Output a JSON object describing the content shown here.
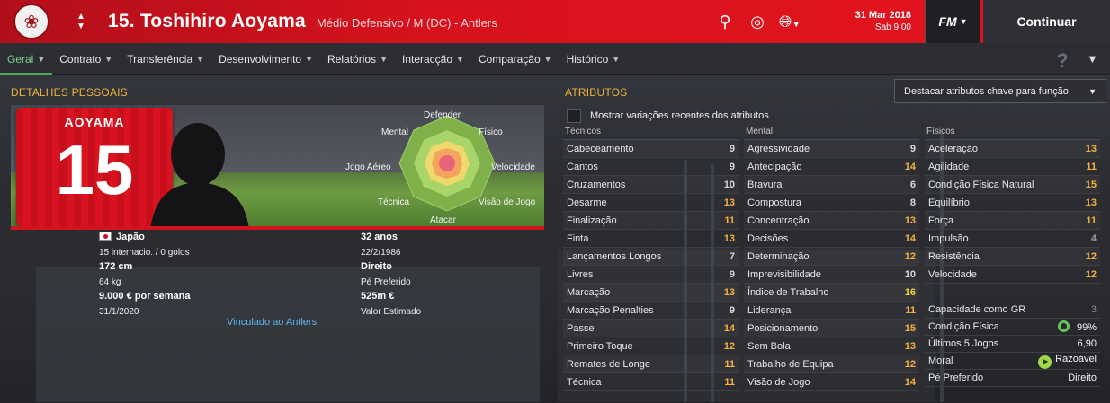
{
  "header": {
    "player_title": "15. Toshihiro Aoyama",
    "subtitle": "Médio Defensivo / M (DC) - Antlers",
    "date_line1": "31 Mar 2018",
    "date_line2": "Sab 9:00",
    "fm_label": "FM",
    "continue_label": "Continuar"
  },
  "tabs": [
    {
      "label": "Geral"
    },
    {
      "label": "Contrato"
    },
    {
      "label": "Transferência"
    },
    {
      "label": "Desenvolvimento"
    },
    {
      "label": "Relatórios"
    },
    {
      "label": "Interacção"
    },
    {
      "label": "Comparação"
    },
    {
      "label": "Histórico"
    }
  ],
  "personal": {
    "section_title": "DETALHES PESSOAIS",
    "shirt_name": "AOYAMA",
    "shirt_number": "15",
    "polar": {
      "top": "Defender",
      "top_left": "Mental",
      "top_right": "Físico",
      "left": "Jogo Aéreo",
      "right": "Velocidade",
      "bottom_left": "Técnica",
      "bottom_right": "Visão de Jogo",
      "bottom": "Atacar"
    },
    "nation": "Japão",
    "caps": "15 internacio. / 0 golos",
    "height": "172 cm",
    "weight": "64 kg",
    "wage": "9.000 € por semana",
    "contract_end": "31/1/2020",
    "age": "32 anos",
    "dob": "22/2/1986",
    "foot": "Direito",
    "foot_label": "Pé Preferido",
    "value": "525m €",
    "value_label": "Valor Estimado",
    "club_link": "Vinculado ao Antlers"
  },
  "attributes": {
    "section_title": "ATRIBUTOS",
    "dropdown": "Destacar atributos chave para função",
    "checkbox_label": "Mostrar variações recentes dos atributos",
    "technical_title": "Técnicos",
    "mental_title": "Mental",
    "physical_title": "Físicos",
    "technical": [
      {
        "name": "Cabeceamento",
        "value": "9",
        "c": ""
      },
      {
        "name": "Cantos",
        "value": "9",
        "c": ""
      },
      {
        "name": "Cruzamentos",
        "value": "10",
        "c": ""
      },
      {
        "name": "Desarme",
        "value": "13",
        "c": "y"
      },
      {
        "name": "Finalização",
        "value": "11",
        "c": "y"
      },
      {
        "name": "Finta",
        "value": "13",
        "c": "y"
      },
      {
        "name": "Lançamentos Longos",
        "value": "7",
        "c": ""
      },
      {
        "name": "Livres",
        "value": "9",
        "c": ""
      },
      {
        "name": "Marcação",
        "value": "13",
        "c": "y"
      },
      {
        "name": "Marcação Penalties",
        "value": "9",
        "c": ""
      },
      {
        "name": "Passe",
        "value": "14",
        "c": "y"
      },
      {
        "name": "Primeiro Toque",
        "value": "12",
        "c": "y"
      },
      {
        "name": "Remates de Longe",
        "value": "11",
        "c": "y"
      },
      {
        "name": "Técnica",
        "value": "11",
        "c": "y"
      }
    ],
    "mental": [
      {
        "name": "Agressividade",
        "value": "9",
        "c": ""
      },
      {
        "name": "Antecipação",
        "value": "14",
        "c": "y"
      },
      {
        "name": "Bravura",
        "value": "6",
        "c": ""
      },
      {
        "name": "Compostura",
        "value": "8",
        "c": ""
      },
      {
        "name": "Concentração",
        "value": "13",
        "c": "y"
      },
      {
        "name": "Decisões",
        "value": "14",
        "c": "y"
      },
      {
        "name": "Determinação",
        "value": "12",
        "c": "y"
      },
      {
        "name": "Imprevisibilidade",
        "value": "10",
        "c": ""
      },
      {
        "name": "Índice de Trabalho",
        "value": "16",
        "c": "hi"
      },
      {
        "name": "Liderança",
        "value": "11",
        "c": "y"
      },
      {
        "name": "Posicionamento",
        "value": "15",
        "c": "y"
      },
      {
        "name": "Sem Bola",
        "value": "13",
        "c": "y"
      },
      {
        "name": "Trabalho de Equipa",
        "value": "12",
        "c": "y"
      },
      {
        "name": "Visão de Jogo",
        "value": "14",
        "c": "y"
      }
    ],
    "physical": [
      {
        "name": "Aceleração",
        "value": "13",
        "c": "y"
      },
      {
        "name": "Agilidade",
        "value": "11",
        "c": "y"
      },
      {
        "name": "Condição Física Natural",
        "value": "15",
        "c": "y"
      },
      {
        "name": "Equilíbrio",
        "value": "13",
        "c": "y"
      },
      {
        "name": "Força",
        "value": "11",
        "c": "y"
      },
      {
        "name": "Impulsão",
        "value": "4",
        "c": "g"
      },
      {
        "name": "Resistência",
        "value": "12",
        "c": "y"
      },
      {
        "name": "Velocidade",
        "value": "12",
        "c": "y"
      }
    ],
    "extras": {
      "gr_label": "Capacidade como GR",
      "gr_value": "3",
      "condition_label": "Condição Física",
      "condition_value": "99%",
      "last5_label": "Últimos 5 Jogos",
      "last5_value": "6,90",
      "moral_label": "Moral",
      "moral_value": "Razoável",
      "foot_label": "Pé Preferido",
      "foot_value": "Direito"
    }
  }
}
